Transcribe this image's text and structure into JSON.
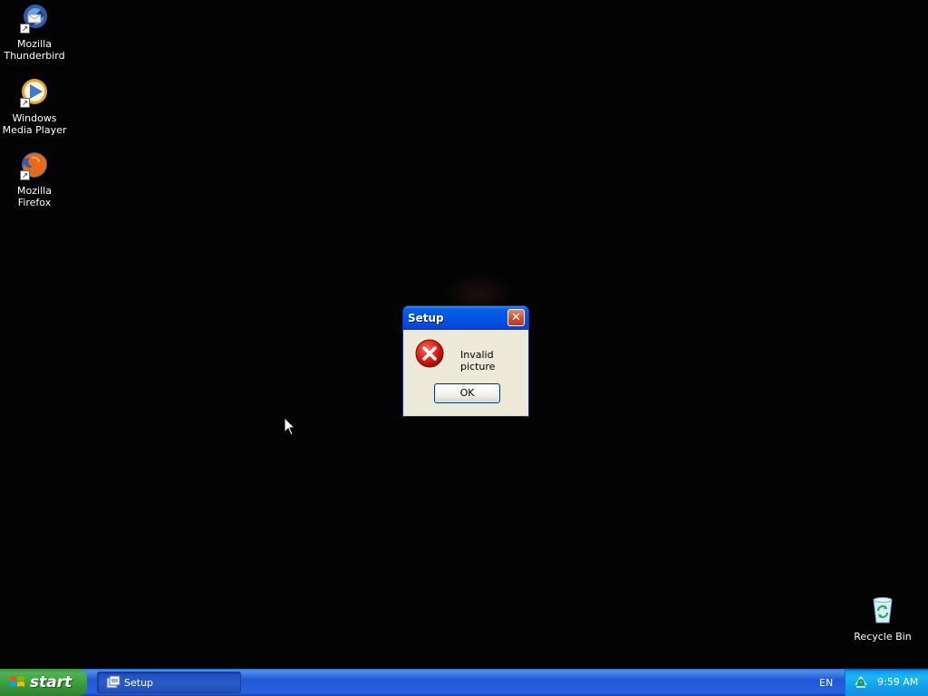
{
  "desktop": {
    "icons": [
      {
        "label": "Mozilla Thunderbird",
        "icon": "thunderbird-icon"
      },
      {
        "label": "Windows Media Player",
        "icon": "media-player-icon"
      },
      {
        "label": "Mozilla Firefox",
        "icon": "firefox-icon"
      },
      {
        "label": "Recycle Bin",
        "icon": "recycle-bin-icon"
      }
    ]
  },
  "dialog": {
    "title": "Setup",
    "close_label": "✕",
    "message": "Invalid picture",
    "ok_label": "OK",
    "icon": "error-icon"
  },
  "taskbar": {
    "start_label": "start",
    "tasks": [
      {
        "label": "Setup"
      }
    ],
    "language": "EN",
    "clock": "9:59 AM"
  },
  "colors": {
    "titlebar": "#0055e5",
    "taskbar": "#2157d7",
    "start_green": "#3a9a3a",
    "tray": "#18b9f2"
  }
}
